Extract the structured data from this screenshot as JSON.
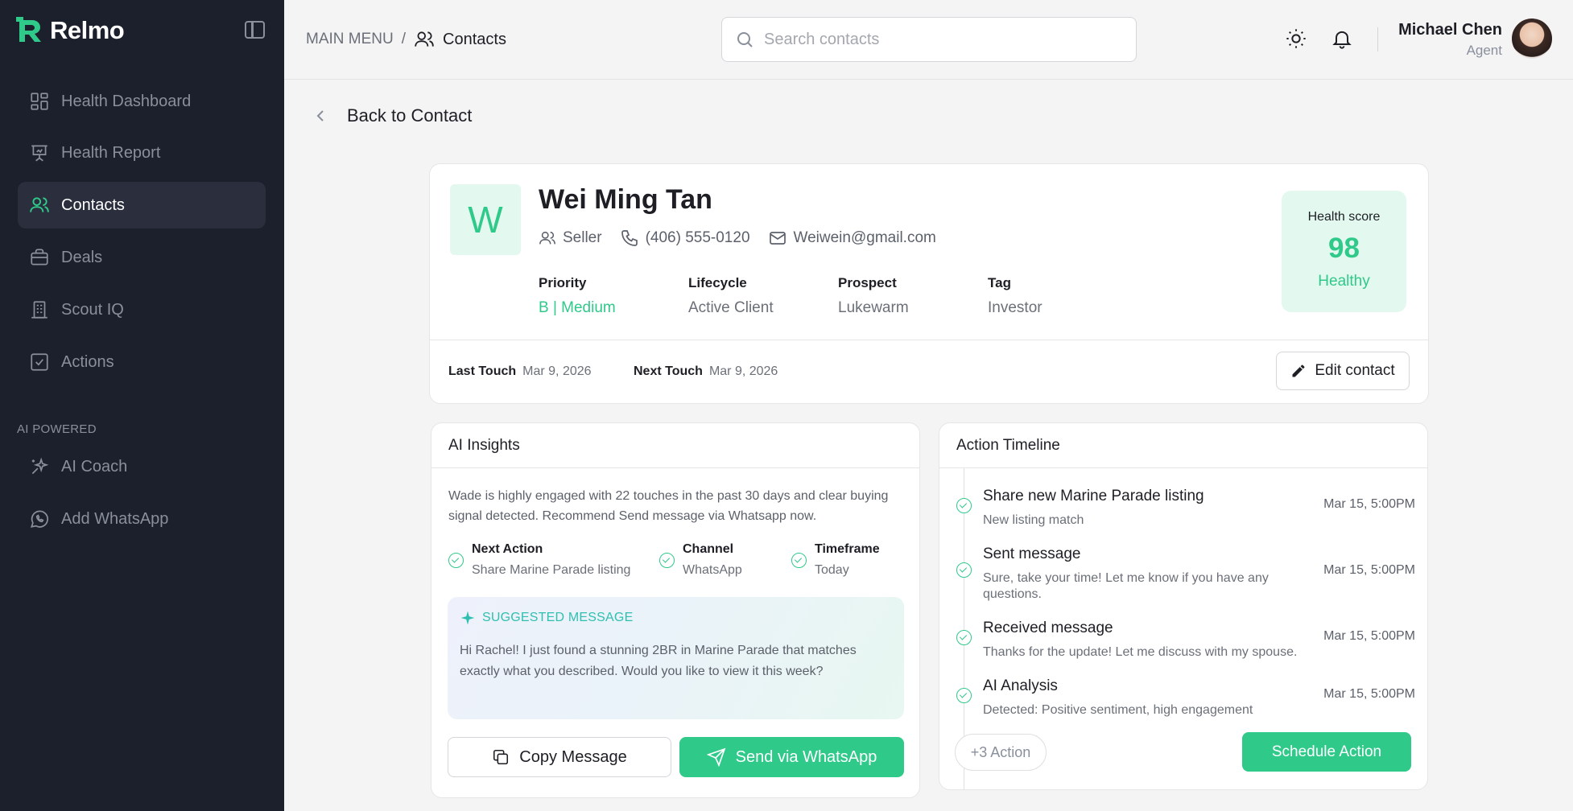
{
  "brand": {
    "name": "Relmo",
    "color": "#2fc98a"
  },
  "sidebar": {
    "items": [
      {
        "label": "Health Dashboard",
        "icon": "dashboard-icon"
      },
      {
        "label": "Health Report",
        "icon": "presentation-icon"
      },
      {
        "label": "Contacts",
        "icon": "users-icon",
        "active": true
      },
      {
        "label": "Deals",
        "icon": "briefcase-icon"
      },
      {
        "label": "Scout IQ",
        "icon": "building-icon"
      },
      {
        "label": "Actions",
        "icon": "checkbox-icon"
      }
    ],
    "section_label": "AI POWERED",
    "ai_items": [
      {
        "label": "AI Coach",
        "icon": "sparkles-icon"
      },
      {
        "label": "Add WhatsApp",
        "icon": "whatsapp-icon"
      }
    ]
  },
  "header": {
    "breadcrumb_root": "MAIN MENU",
    "breadcrumb_sep": "/",
    "breadcrumb_current": "Contacts",
    "search_placeholder": "Search contacts",
    "user_name": "Michael Chen",
    "user_role": "Agent"
  },
  "back_label": "Back to Contact",
  "contact": {
    "initial": "W",
    "name": "Wei Ming Tan",
    "role": "Seller",
    "phone": "(406) 555-0120",
    "email": "Weiwein@gmail.com",
    "attributes": [
      {
        "key": "Priority",
        "value": "B | Medium"
      },
      {
        "key": "Lifecycle",
        "value": "Active Client"
      },
      {
        "key": "Prospect",
        "value": "Lukewarm"
      },
      {
        "key": "Tag",
        "value": "Investor"
      }
    ],
    "health_label": "Health score",
    "health_score": "98",
    "health_status": "Healthy",
    "last_touch_label": "Last Touch",
    "last_touch": "Mar 9, 2026",
    "next_touch_label": "Next Touch",
    "next_touch": "Mar 9, 2026",
    "edit_label": "Edit contact"
  },
  "insights": {
    "title": "AI Insights",
    "summary": "Wade is highly engaged with 22 touches in the past 30 days and clear buying signal detected. Recommend Send message via Whatsapp now.",
    "steps": [
      {
        "title": "Next Action",
        "detail": "Share Marine Parade listing"
      },
      {
        "title": "Channel",
        "detail": "WhatsApp"
      },
      {
        "title": "Timeframe",
        "detail": "Today"
      }
    ],
    "suggested_label": "SUGGESTED MESSAGE",
    "suggested_message": "Hi Rachel! I just found a stunning 2BR in Marine Parade that matches exactly what you described. Would you like to view it this week?",
    "copy_label": "Copy Message",
    "send_label": "Send via WhatsApp"
  },
  "timeline": {
    "title": "Action Timeline",
    "items": [
      {
        "title": "Share new Marine Parade listing",
        "detail": "New listing match",
        "date": "Mar 15, 5:00PM"
      },
      {
        "title": "Sent message",
        "detail": "Sure, take your time! Let me know if you have any questions.",
        "date": "Mar 15, 5:00PM"
      },
      {
        "title": "Received message",
        "detail": "Thanks for the update! Let me discuss with my spouse.",
        "date": "Mar 15, 5:00PM"
      },
      {
        "title": "AI Analysis",
        "detail": "Detected: Positive sentiment, high engagement",
        "date": "Mar 15, 5:00PM"
      }
    ],
    "more_label": "+3 Action",
    "schedule_label": "Schedule Action"
  }
}
